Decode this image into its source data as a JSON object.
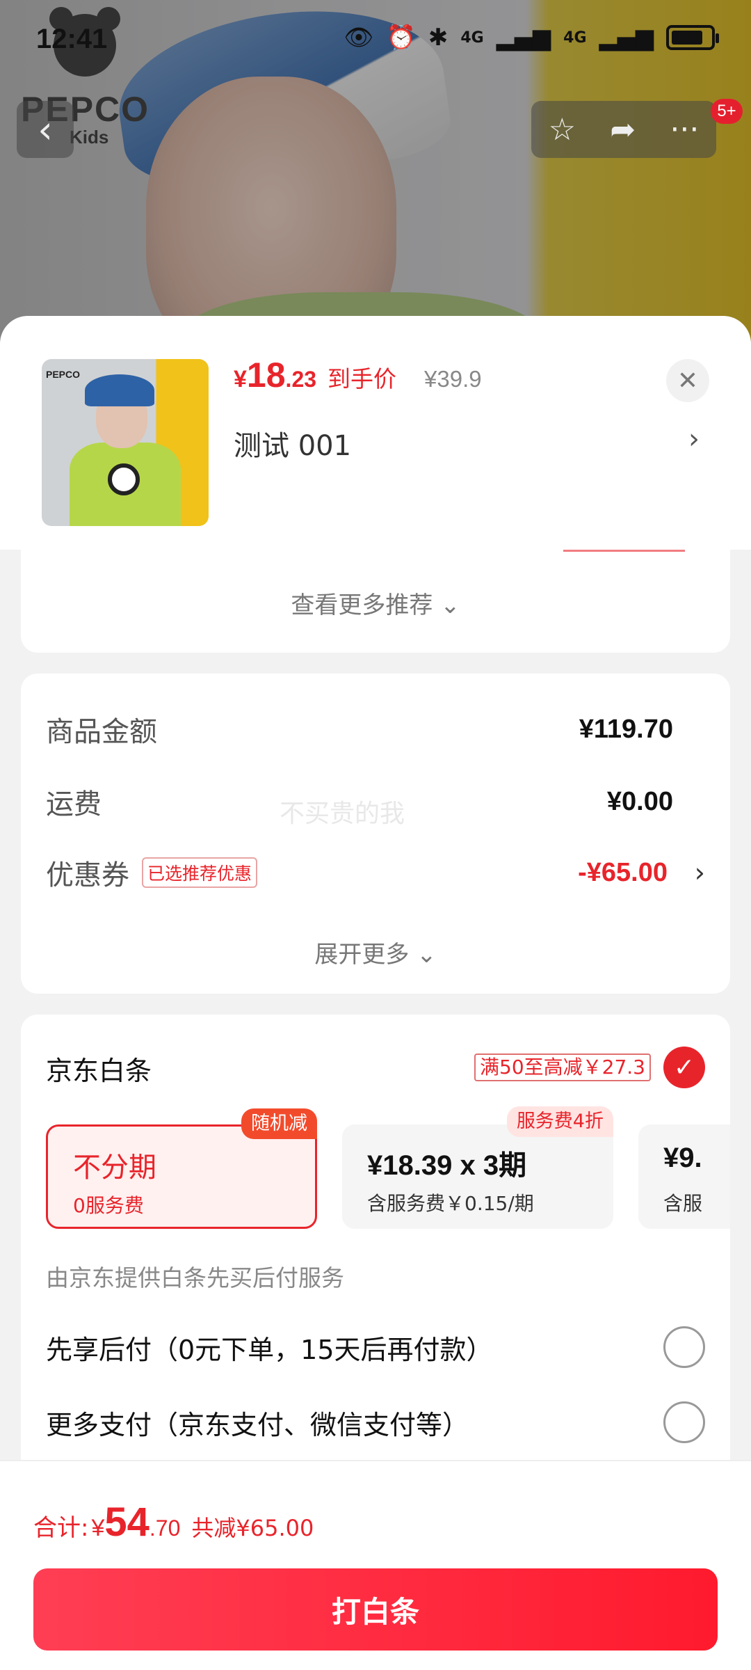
{
  "status_bar": {
    "time": "12:41",
    "net1": "4G",
    "net2": "4G"
  },
  "hero": {
    "brand": "PEPCO",
    "brand_sub": "Kids"
  },
  "top_bar": {
    "back_glyph": "‹",
    "fav_glyph": "☆",
    "share_glyph": "➦",
    "more_glyph": "···",
    "badge": "5+"
  },
  "product": {
    "price_currency": "¥",
    "price_int": "18",
    "price_dec": ".23",
    "price_tag": "到手价",
    "original_price": "¥39.9",
    "sku": "测试  001",
    "thumb_logo": "PEPCO"
  },
  "recommend": {
    "more_label": "查看更多推荐 ⌄"
  },
  "summary": {
    "rows": [
      {
        "label": "商品金额",
        "value": "¥119.70"
      },
      {
        "label": "运费",
        "value": "¥0.00"
      },
      {
        "label": "优惠券",
        "value": "-¥65.00",
        "tag": "已选推荐优惠"
      }
    ],
    "watermark": "不买贵的我",
    "expand_label": "展开更多 ⌄"
  },
  "payment": {
    "title": "京东白条",
    "promo": "满50至高减￥27.3",
    "plans": [
      {
        "main": "不分期",
        "sub": "0服务费",
        "badge": "随机减"
      },
      {
        "main": "¥18.39 x 3期",
        "sub": "含服务费￥0.15/期",
        "badge": "服务费4折"
      },
      {
        "main": "¥9.",
        "sub": "含服"
      }
    ],
    "note": "由京东提供白条先买后付服务",
    "options": [
      "先享后付（0元下单，15天后再付款）",
      "更多支付（京东支付、微信支付等）"
    ]
  },
  "footer": {
    "total_label": "合计:",
    "total_currency": "¥",
    "total_int": "54",
    "total_dec": ".70",
    "save_label": "共减¥65.00",
    "submit_label": "打白条"
  },
  "colors": {
    "accent": "#e8242b",
    "button": "#ff1a2e"
  }
}
